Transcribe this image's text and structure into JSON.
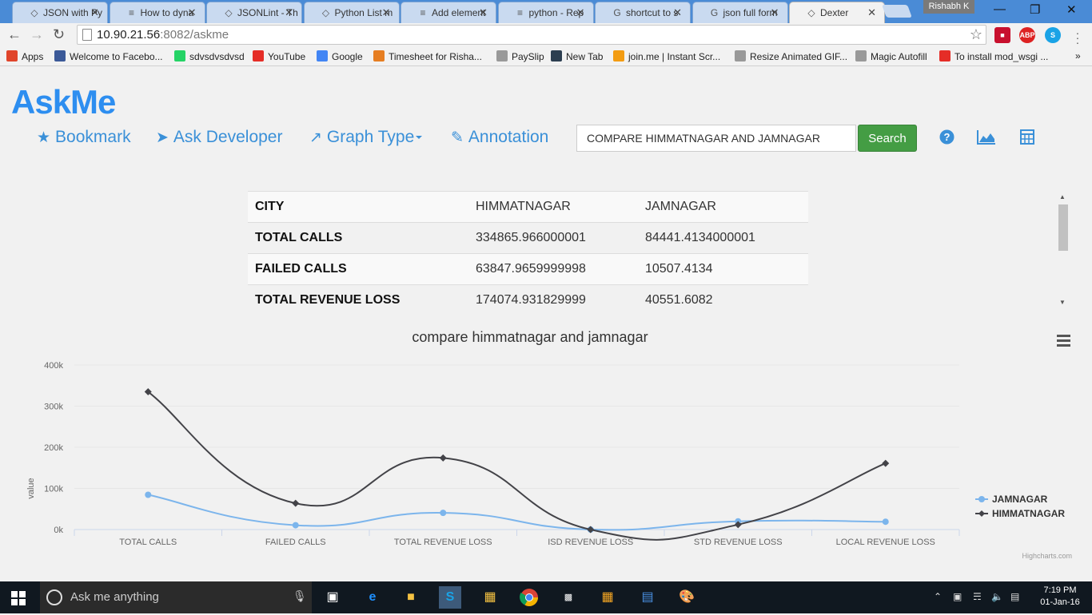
{
  "browser": {
    "tabs": [
      {
        "title": "JSON with Py",
        "icon": "json-icon"
      },
      {
        "title": "How to dyna",
        "icon": "stackoverflow-icon"
      },
      {
        "title": "JSONLint - Th",
        "icon": "json-icon"
      },
      {
        "title": "Python List m",
        "icon": "json-icon"
      },
      {
        "title": "Add element",
        "icon": "stackoverflow-icon"
      },
      {
        "title": "python - Rep",
        "icon": "stackoverflow-icon"
      },
      {
        "title": "shortcut to s",
        "icon": "google-icon"
      },
      {
        "title": "json full form",
        "icon": "google-icon"
      },
      {
        "title": "Dexter",
        "icon": "dexter-icon"
      }
    ],
    "profile_name": "Rishabh K",
    "address": {
      "host": "10.90.21.56",
      "rest": ":8082/askme"
    },
    "bookmarks": [
      {
        "label": "Apps",
        "icon": "apps-icon"
      },
      {
        "label": "Welcome to Facebo...",
        "icon": "facebook-icon"
      },
      {
        "label": "sdvsdvsdvsd",
        "icon": "whatsapp-icon"
      },
      {
        "label": "YouTube",
        "icon": "youtube-icon"
      },
      {
        "label": "Google",
        "icon": "google-icon"
      },
      {
        "label": "Timesheet for Risha...",
        "icon": "timesheet-icon"
      },
      {
        "label": "PaySlip",
        "icon": "page-icon"
      },
      {
        "label": "New Tab",
        "icon": "newtab-icon"
      },
      {
        "label": "join.me | Instant Scr...",
        "icon": "joinme-icon"
      },
      {
        "label": "Resize Animated GIF...",
        "icon": "page-icon"
      },
      {
        "label": "Magic Autofill",
        "icon": "page-icon"
      },
      {
        "label": "To install mod_wsgi ...",
        "icon": "youtube-icon"
      }
    ]
  },
  "app": {
    "logo": "AskMe",
    "nav": {
      "bookmark": "Bookmark",
      "ask_developer": "Ask Developer",
      "graph_type": "Graph Type",
      "annotation": "Annotation"
    },
    "search": {
      "value": "COMPARE HIMMATNAGAR AND JAMNAGAR",
      "button": "Search"
    },
    "colors": {
      "accent": "#3a90d8",
      "search_button": "#449d44",
      "logo": "#2d8ef0"
    }
  },
  "table": {
    "rows": [
      [
        "CITY",
        "HIMMATNAGAR",
        "JAMNAGAR"
      ],
      [
        "TOTAL CALLS",
        "334865.966000001",
        "84441.4134000001"
      ],
      [
        "FAILED CALLS",
        "63847.9659999998",
        "10507.4134"
      ],
      [
        "TOTAL REVENUE LOSS",
        "174074.931829999",
        "40551.6082"
      ]
    ]
  },
  "chart_data": {
    "type": "line",
    "title": "compare himmatnagar and jamnagar",
    "ylabel": "value",
    "xlabel": "",
    "categories": [
      "TOTAL CALLS",
      "FAILED CALLS",
      "TOTAL REVENUE LOSS",
      "ISD REVENUE LOSS",
      "STD REVENUE LOSS",
      "LOCAL REVENUE LOSS"
    ],
    "y_ticks": [
      "0k",
      "100k",
      "200k",
      "300k",
      "400k"
    ],
    "ylim": [
      0,
      400000
    ],
    "grid": true,
    "legend_position": "right",
    "credit": "Highcharts.com",
    "series": [
      {
        "name": "JAMNAGAR",
        "color": "#7cb5ec",
        "values": [
          84441,
          10507,
          40552,
          0,
          20000,
          19000
        ]
      },
      {
        "name": "HIMMATNAGAR",
        "color": "#434348",
        "values": [
          334866,
          63848,
          174075,
          0,
          12000,
          161000
        ]
      }
    ]
  },
  "taskbar": {
    "search_placeholder": "Ask me anything",
    "time": "7:19 PM",
    "date": "01-Jan-16"
  }
}
